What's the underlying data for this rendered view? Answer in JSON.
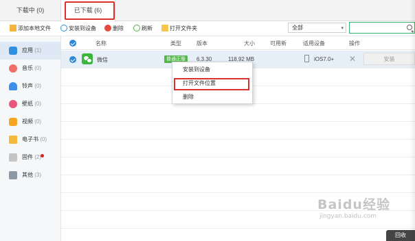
{
  "tabs": [
    {
      "label": "下载中 (0)"
    },
    {
      "label": "已下载 (6)"
    }
  ],
  "toolbar": {
    "add_local": "添加本地文件",
    "install_to_device": "安装到设备",
    "delete": "删除",
    "refresh": "刷新",
    "open_folder": "打开文件夹"
  },
  "filter": {
    "selected": "全部",
    "caret": "▾"
  },
  "search": {
    "placeholder": ""
  },
  "sidebar": {
    "items": [
      {
        "label": "应用",
        "count": "(1)",
        "icon": "app-store-icon",
        "color": "#2f8fe0"
      },
      {
        "label": "音乐",
        "count": "(0)",
        "icon": "music-icon",
        "color": "#ef6e66"
      },
      {
        "label": "铃声",
        "count": "(0)",
        "icon": "bell-icon",
        "color": "#3b8fe6"
      },
      {
        "label": "壁纸",
        "count": "(0)",
        "icon": "wallpaper-icon",
        "color": "#e9557e"
      },
      {
        "label": "视频",
        "count": "(0)",
        "icon": "video-icon",
        "color": "#f5a623"
      },
      {
        "label": "电子书",
        "count": "(0)",
        "icon": "ebook-icon",
        "color": "#f5b83c"
      },
      {
        "label": "固件",
        "count": "(2)",
        "icon": "firmware-icon",
        "color": "#b8b8b8"
      },
      {
        "label": "其他",
        "count": "(3)",
        "icon": "other-icon",
        "color": "#8c9aa8"
      }
    ]
  },
  "table": {
    "headers": {
      "name": "名称",
      "type": "类型",
      "version": "版本",
      "size": "大小",
      "device": "可用新",
      "compat": "适用设备",
      "action": "操作"
    },
    "rows": [
      {
        "name": "微信",
        "type": "普通正版",
        "version": "6.3.30",
        "size": "118.92 MB",
        "compat": "iOS7.0+",
        "install": "安装",
        "close": "✕"
      }
    ]
  },
  "context_menu": {
    "items": [
      {
        "label": "安装到设备"
      },
      {
        "label": "打开文件位置"
      },
      {
        "label": "删除"
      }
    ]
  },
  "watermark": {
    "main": "Baidu经验",
    "sub": "jingyan.baidu.com"
  },
  "corner_button": {
    "label": "回收"
  },
  "colors": {
    "accent": "#2d87d6",
    "highlight_frame": "#d9302c",
    "wechat_green": "#3bb53b",
    "search_border": "#35b06a"
  }
}
